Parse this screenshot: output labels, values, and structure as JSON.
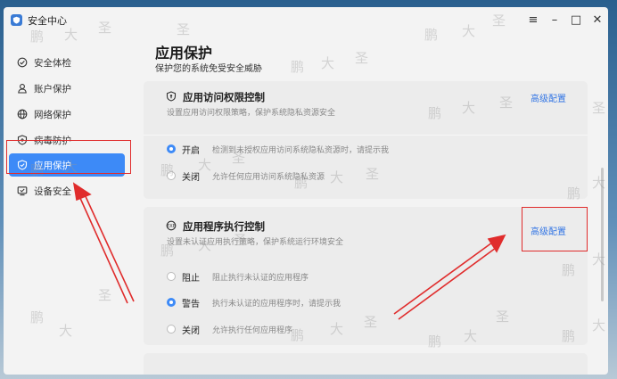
{
  "app": {
    "title": "安全中心",
    "controls": [
      "≡",
      "–",
      "□",
      "✕"
    ]
  },
  "sidebar": {
    "items": [
      {
        "label": "安全体检",
        "icon": "check-shield-icon",
        "active": false
      },
      {
        "label": "账户保护",
        "icon": "user-icon",
        "active": false
      },
      {
        "label": "网络保护",
        "icon": "globe-icon",
        "active": false
      },
      {
        "label": "病毒防护",
        "icon": "shield-plus-icon",
        "active": false
      },
      {
        "label": "应用保护",
        "icon": "shield-icon",
        "active": true
      },
      {
        "label": "设备安全",
        "icon": "monitor-icon",
        "active": false
      }
    ]
  },
  "page": {
    "title": "应用保护",
    "subtitle": "保护您的系统免受安全威胁"
  },
  "cards": [
    {
      "title": "应用访问权限控制",
      "icon": "shield-icon",
      "description": "设置应用访问权限策略，保护系统隐私资源安全",
      "link": "高级配置",
      "options": [
        {
          "label": "开启",
          "desc": "检测到未授权应用访问系统隐私资源时，请提示我",
          "checked": true
        },
        {
          "label": "关闭",
          "desc": "允许任何应用访问系统隐私资源",
          "checked": false
        }
      ]
    },
    {
      "title": "应用程序执行控制",
      "icon": "exec-icon",
      "description": "设置未认证应用执行策略，保护系统运行环境安全",
      "link": "高级配置",
      "options": [
        {
          "label": "阻止",
          "desc": "阻止执行未认证的应用程序",
          "checked": false
        },
        {
          "label": "警告",
          "desc": "执行未认证的应用程序时，请提示我",
          "checked": true
        },
        {
          "label": "关闭",
          "desc": "允许执行任何应用程序",
          "checked": false
        }
      ]
    }
  ],
  "watermark": [
    "鹏",
    "大",
    "圣"
  ],
  "colors": {
    "accent": "#3d8af7",
    "link": "#3275e4",
    "annotation": "#e02c2c"
  }
}
